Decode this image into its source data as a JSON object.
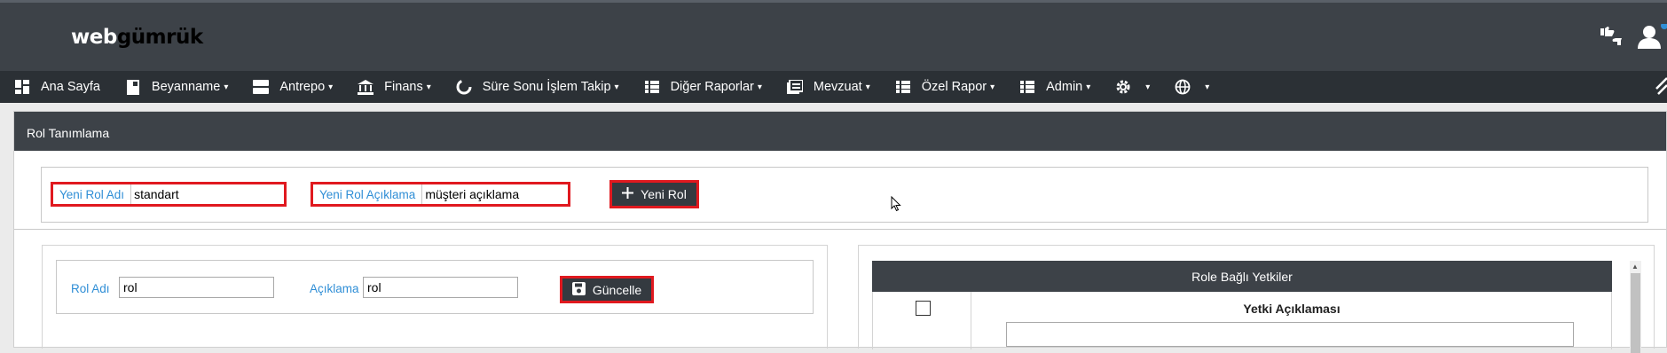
{
  "brand": {
    "part1": "web",
    "part2": "gümrük"
  },
  "top_icons": [
    "thumbs-icon",
    "user-icon"
  ],
  "nav": {
    "items": [
      {
        "label": "Ana Sayfa",
        "icon": "dashboard-icon",
        "has_menu": false
      },
      {
        "label": "Beyanname",
        "icon": "document-icon",
        "has_menu": true
      },
      {
        "label": "Antrepo",
        "icon": "warehouse-icon",
        "has_menu": true
      },
      {
        "label": "Finans",
        "icon": "bank-icon",
        "has_menu": true
      },
      {
        "label": "Süre Sonu İşlem Takip",
        "icon": "circle-progress-icon",
        "has_menu": true
      },
      {
        "label": "Diğer Raporlar",
        "icon": "grid-icon",
        "has_menu": true
      },
      {
        "label": "Mevzuat",
        "icon": "book-icon",
        "has_menu": true
      },
      {
        "label": "Özel Rapor",
        "icon": "grid-icon",
        "has_menu": true
      },
      {
        "label": "Admin",
        "icon": "grid-icon",
        "has_menu": true
      },
      {
        "label": "",
        "icon": "gear-icon",
        "has_menu": true
      },
      {
        "label": "",
        "icon": "globe-icon",
        "has_menu": true
      }
    ],
    "chevron": "⌄"
  },
  "panel": {
    "title": "Rol Tanımlama"
  },
  "new_role": {
    "name_label": "Yeni Rol Adı",
    "name_value": "standart",
    "desc_label": "Yeni Rol Açıklama",
    "desc_value": "müşteri açıklama",
    "button_label": "Yeni Rol"
  },
  "edit_role": {
    "name_label": "Rol Adı",
    "name_value": "rol",
    "desc_label": "Açıklama",
    "desc_value": "rol",
    "button_label": "Güncelle"
  },
  "permissions": {
    "title": "Role Bağlı Yetkiler",
    "column_title": "Yetki Açıklaması"
  },
  "colors": {
    "topbar": "#3d4248",
    "navbar": "#2b3035",
    "highlight": "#e0191f",
    "label_blue": "#2f8ed6"
  }
}
